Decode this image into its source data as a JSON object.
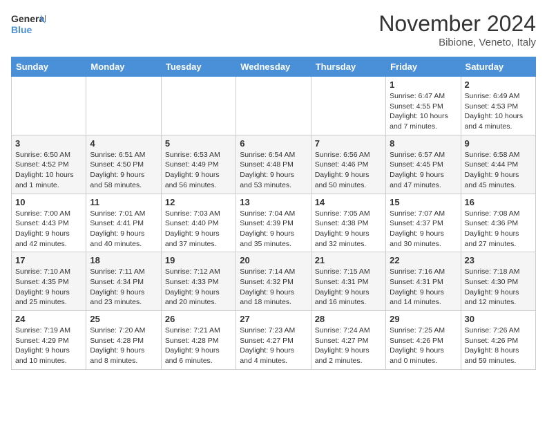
{
  "header": {
    "logo_line1": "General",
    "logo_line2": "Blue",
    "month": "November 2024",
    "location": "Bibione, Veneto, Italy"
  },
  "weekdays": [
    "Sunday",
    "Monday",
    "Tuesday",
    "Wednesday",
    "Thursday",
    "Friday",
    "Saturday"
  ],
  "weeks": [
    [
      {
        "day": "",
        "info": ""
      },
      {
        "day": "",
        "info": ""
      },
      {
        "day": "",
        "info": ""
      },
      {
        "day": "",
        "info": ""
      },
      {
        "day": "",
        "info": ""
      },
      {
        "day": "1",
        "info": "Sunrise: 6:47 AM\nSunset: 4:55 PM\nDaylight: 10 hours and 7 minutes."
      },
      {
        "day": "2",
        "info": "Sunrise: 6:49 AM\nSunset: 4:53 PM\nDaylight: 10 hours and 4 minutes."
      }
    ],
    [
      {
        "day": "3",
        "info": "Sunrise: 6:50 AM\nSunset: 4:52 PM\nDaylight: 10 hours and 1 minute."
      },
      {
        "day": "4",
        "info": "Sunrise: 6:51 AM\nSunset: 4:50 PM\nDaylight: 9 hours and 58 minutes."
      },
      {
        "day": "5",
        "info": "Sunrise: 6:53 AM\nSunset: 4:49 PM\nDaylight: 9 hours and 56 minutes."
      },
      {
        "day": "6",
        "info": "Sunrise: 6:54 AM\nSunset: 4:48 PM\nDaylight: 9 hours and 53 minutes."
      },
      {
        "day": "7",
        "info": "Sunrise: 6:56 AM\nSunset: 4:46 PM\nDaylight: 9 hours and 50 minutes."
      },
      {
        "day": "8",
        "info": "Sunrise: 6:57 AM\nSunset: 4:45 PM\nDaylight: 9 hours and 47 minutes."
      },
      {
        "day": "9",
        "info": "Sunrise: 6:58 AM\nSunset: 4:44 PM\nDaylight: 9 hours and 45 minutes."
      }
    ],
    [
      {
        "day": "10",
        "info": "Sunrise: 7:00 AM\nSunset: 4:43 PM\nDaylight: 9 hours and 42 minutes."
      },
      {
        "day": "11",
        "info": "Sunrise: 7:01 AM\nSunset: 4:41 PM\nDaylight: 9 hours and 40 minutes."
      },
      {
        "day": "12",
        "info": "Sunrise: 7:03 AM\nSunset: 4:40 PM\nDaylight: 9 hours and 37 minutes."
      },
      {
        "day": "13",
        "info": "Sunrise: 7:04 AM\nSunset: 4:39 PM\nDaylight: 9 hours and 35 minutes."
      },
      {
        "day": "14",
        "info": "Sunrise: 7:05 AM\nSunset: 4:38 PM\nDaylight: 9 hours and 32 minutes."
      },
      {
        "day": "15",
        "info": "Sunrise: 7:07 AM\nSunset: 4:37 PM\nDaylight: 9 hours and 30 minutes."
      },
      {
        "day": "16",
        "info": "Sunrise: 7:08 AM\nSunset: 4:36 PM\nDaylight: 9 hours and 27 minutes."
      }
    ],
    [
      {
        "day": "17",
        "info": "Sunrise: 7:10 AM\nSunset: 4:35 PM\nDaylight: 9 hours and 25 minutes."
      },
      {
        "day": "18",
        "info": "Sunrise: 7:11 AM\nSunset: 4:34 PM\nDaylight: 9 hours and 23 minutes."
      },
      {
        "day": "19",
        "info": "Sunrise: 7:12 AM\nSunset: 4:33 PM\nDaylight: 9 hours and 20 minutes."
      },
      {
        "day": "20",
        "info": "Sunrise: 7:14 AM\nSunset: 4:32 PM\nDaylight: 9 hours and 18 minutes."
      },
      {
        "day": "21",
        "info": "Sunrise: 7:15 AM\nSunset: 4:31 PM\nDaylight: 9 hours and 16 minutes."
      },
      {
        "day": "22",
        "info": "Sunrise: 7:16 AM\nSunset: 4:31 PM\nDaylight: 9 hours and 14 minutes."
      },
      {
        "day": "23",
        "info": "Sunrise: 7:18 AM\nSunset: 4:30 PM\nDaylight: 9 hours and 12 minutes."
      }
    ],
    [
      {
        "day": "24",
        "info": "Sunrise: 7:19 AM\nSunset: 4:29 PM\nDaylight: 9 hours and 10 minutes."
      },
      {
        "day": "25",
        "info": "Sunrise: 7:20 AM\nSunset: 4:28 PM\nDaylight: 9 hours and 8 minutes."
      },
      {
        "day": "26",
        "info": "Sunrise: 7:21 AM\nSunset: 4:28 PM\nDaylight: 9 hours and 6 minutes."
      },
      {
        "day": "27",
        "info": "Sunrise: 7:23 AM\nSunset: 4:27 PM\nDaylight: 9 hours and 4 minutes."
      },
      {
        "day": "28",
        "info": "Sunrise: 7:24 AM\nSunset: 4:27 PM\nDaylight: 9 hours and 2 minutes."
      },
      {
        "day": "29",
        "info": "Sunrise: 7:25 AM\nSunset: 4:26 PM\nDaylight: 9 hours and 0 minutes."
      },
      {
        "day": "30",
        "info": "Sunrise: 7:26 AM\nSunset: 4:26 PM\nDaylight: 8 hours and 59 minutes."
      }
    ]
  ]
}
